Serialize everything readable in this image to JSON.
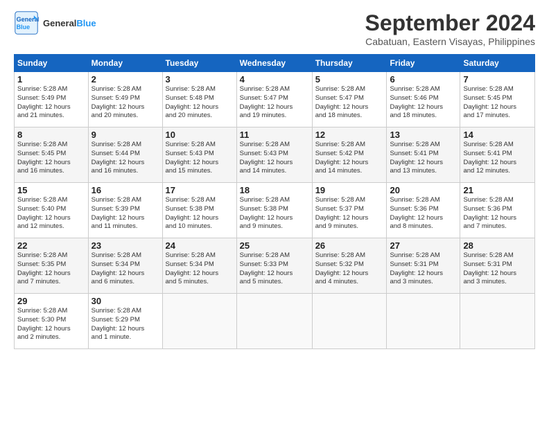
{
  "header": {
    "logo_line1": "General",
    "logo_line2": "Blue",
    "month_title": "September 2024",
    "location": "Cabatuan, Eastern Visayas, Philippines"
  },
  "calendar": {
    "days_of_week": [
      "Sunday",
      "Monday",
      "Tuesday",
      "Wednesday",
      "Thursday",
      "Friday",
      "Saturday"
    ],
    "weeks": [
      [
        {
          "day": "",
          "detail": ""
        },
        {
          "day": "2",
          "detail": "Sunrise: 5:28 AM\nSunset: 5:49 PM\nDaylight: 12 hours\nand 20 minutes."
        },
        {
          "day": "3",
          "detail": "Sunrise: 5:28 AM\nSunset: 5:48 PM\nDaylight: 12 hours\nand 20 minutes."
        },
        {
          "day": "4",
          "detail": "Sunrise: 5:28 AM\nSunset: 5:47 PM\nDaylight: 12 hours\nand 19 minutes."
        },
        {
          "day": "5",
          "detail": "Sunrise: 5:28 AM\nSunset: 5:47 PM\nDaylight: 12 hours\nand 18 minutes."
        },
        {
          "day": "6",
          "detail": "Sunrise: 5:28 AM\nSunset: 5:46 PM\nDaylight: 12 hours\nand 18 minutes."
        },
        {
          "day": "7",
          "detail": "Sunrise: 5:28 AM\nSunset: 5:45 PM\nDaylight: 12 hours\nand 17 minutes."
        }
      ],
      [
        {
          "day": "8",
          "detail": "Sunrise: 5:28 AM\nSunset: 5:45 PM\nDaylight: 12 hours\nand 16 minutes."
        },
        {
          "day": "9",
          "detail": "Sunrise: 5:28 AM\nSunset: 5:44 PM\nDaylight: 12 hours\nand 16 minutes."
        },
        {
          "day": "10",
          "detail": "Sunrise: 5:28 AM\nSunset: 5:43 PM\nDaylight: 12 hours\nand 15 minutes."
        },
        {
          "day": "11",
          "detail": "Sunrise: 5:28 AM\nSunset: 5:43 PM\nDaylight: 12 hours\nand 14 minutes."
        },
        {
          "day": "12",
          "detail": "Sunrise: 5:28 AM\nSunset: 5:42 PM\nDaylight: 12 hours\nand 14 minutes."
        },
        {
          "day": "13",
          "detail": "Sunrise: 5:28 AM\nSunset: 5:41 PM\nDaylight: 12 hours\nand 13 minutes."
        },
        {
          "day": "14",
          "detail": "Sunrise: 5:28 AM\nSunset: 5:41 PM\nDaylight: 12 hours\nand 12 minutes."
        }
      ],
      [
        {
          "day": "15",
          "detail": "Sunrise: 5:28 AM\nSunset: 5:40 PM\nDaylight: 12 hours\nand 12 minutes."
        },
        {
          "day": "16",
          "detail": "Sunrise: 5:28 AM\nSunset: 5:39 PM\nDaylight: 12 hours\nand 11 minutes."
        },
        {
          "day": "17",
          "detail": "Sunrise: 5:28 AM\nSunset: 5:38 PM\nDaylight: 12 hours\nand 10 minutes."
        },
        {
          "day": "18",
          "detail": "Sunrise: 5:28 AM\nSunset: 5:38 PM\nDaylight: 12 hours\nand 9 minutes."
        },
        {
          "day": "19",
          "detail": "Sunrise: 5:28 AM\nSunset: 5:37 PM\nDaylight: 12 hours\nand 9 minutes."
        },
        {
          "day": "20",
          "detail": "Sunrise: 5:28 AM\nSunset: 5:36 PM\nDaylight: 12 hours\nand 8 minutes."
        },
        {
          "day": "21",
          "detail": "Sunrise: 5:28 AM\nSunset: 5:36 PM\nDaylight: 12 hours\nand 7 minutes."
        }
      ],
      [
        {
          "day": "22",
          "detail": "Sunrise: 5:28 AM\nSunset: 5:35 PM\nDaylight: 12 hours\nand 7 minutes."
        },
        {
          "day": "23",
          "detail": "Sunrise: 5:28 AM\nSunset: 5:34 PM\nDaylight: 12 hours\nand 6 minutes."
        },
        {
          "day": "24",
          "detail": "Sunrise: 5:28 AM\nSunset: 5:34 PM\nDaylight: 12 hours\nand 5 minutes."
        },
        {
          "day": "25",
          "detail": "Sunrise: 5:28 AM\nSunset: 5:33 PM\nDaylight: 12 hours\nand 5 minutes."
        },
        {
          "day": "26",
          "detail": "Sunrise: 5:28 AM\nSunset: 5:32 PM\nDaylight: 12 hours\nand 4 minutes."
        },
        {
          "day": "27",
          "detail": "Sunrise: 5:28 AM\nSunset: 5:31 PM\nDaylight: 12 hours\nand 3 minutes."
        },
        {
          "day": "28",
          "detail": "Sunrise: 5:28 AM\nSunset: 5:31 PM\nDaylight: 12 hours\nand 3 minutes."
        }
      ],
      [
        {
          "day": "29",
          "detail": "Sunrise: 5:28 AM\nSunset: 5:30 PM\nDaylight: 12 hours\nand 2 minutes."
        },
        {
          "day": "30",
          "detail": "Sunrise: 5:28 AM\nSunset: 5:29 PM\nDaylight: 12 hours\nand 1 minute."
        },
        {
          "day": "",
          "detail": ""
        },
        {
          "day": "",
          "detail": ""
        },
        {
          "day": "",
          "detail": ""
        },
        {
          "day": "",
          "detail": ""
        },
        {
          "day": "",
          "detail": ""
        }
      ]
    ],
    "week1_day1": {
      "day": "1",
      "detail": "Sunrise: 5:28 AM\nSunset: 5:49 PM\nDaylight: 12 hours\nand 21 minutes."
    }
  }
}
